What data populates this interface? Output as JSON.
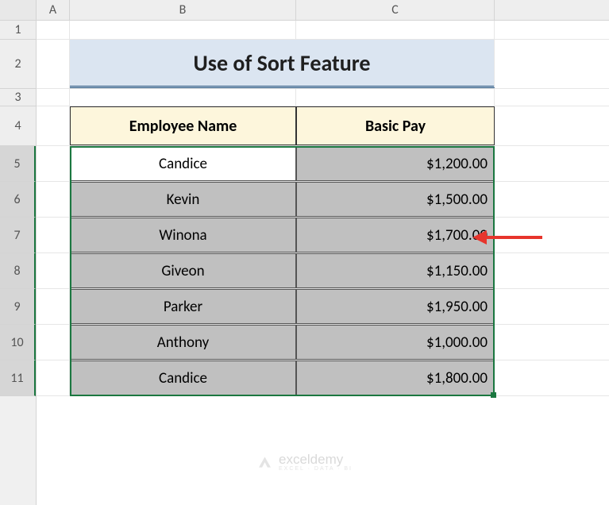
{
  "col_headers": {
    "A": "A",
    "B": "B",
    "C": "C"
  },
  "row_headers": [
    "1",
    "2",
    "3",
    "4",
    "5",
    "6",
    "7",
    "8",
    "9",
    "10",
    "11"
  ],
  "title": "Use of Sort Feature",
  "header": {
    "name": "Employee Name",
    "pay": "Basic Pay"
  },
  "rows": [
    {
      "name": "Candice",
      "pay": "$1,200.00"
    },
    {
      "name": "Kevin",
      "pay": "$1,500.00"
    },
    {
      "name": "Winona",
      "pay": "$1,700.00"
    },
    {
      "name": "Giveon",
      "pay": "$1,150.00"
    },
    {
      "name": "Parker",
      "pay": "$1,950.00"
    },
    {
      "name": "Anthony",
      "pay": "$1,000.00"
    },
    {
      "name": "Candice",
      "pay": "$1,800.00"
    }
  ],
  "watermark": {
    "brand": "exceldemy",
    "sub": "EXCEL · DATA · BI"
  },
  "chart_data": {
    "type": "table",
    "title": "Use of Sort Feature",
    "columns": [
      "Employee Name",
      "Basic Pay"
    ],
    "rows": [
      [
        "Candice",
        1200.0
      ],
      [
        "Kevin",
        1500.0
      ],
      [
        "Winona",
        1700.0
      ],
      [
        "Giveon",
        1150.0
      ],
      [
        "Parker",
        1950.0
      ],
      [
        "Anthony",
        1000.0
      ],
      [
        "Candice",
        1800.0
      ]
    ]
  }
}
